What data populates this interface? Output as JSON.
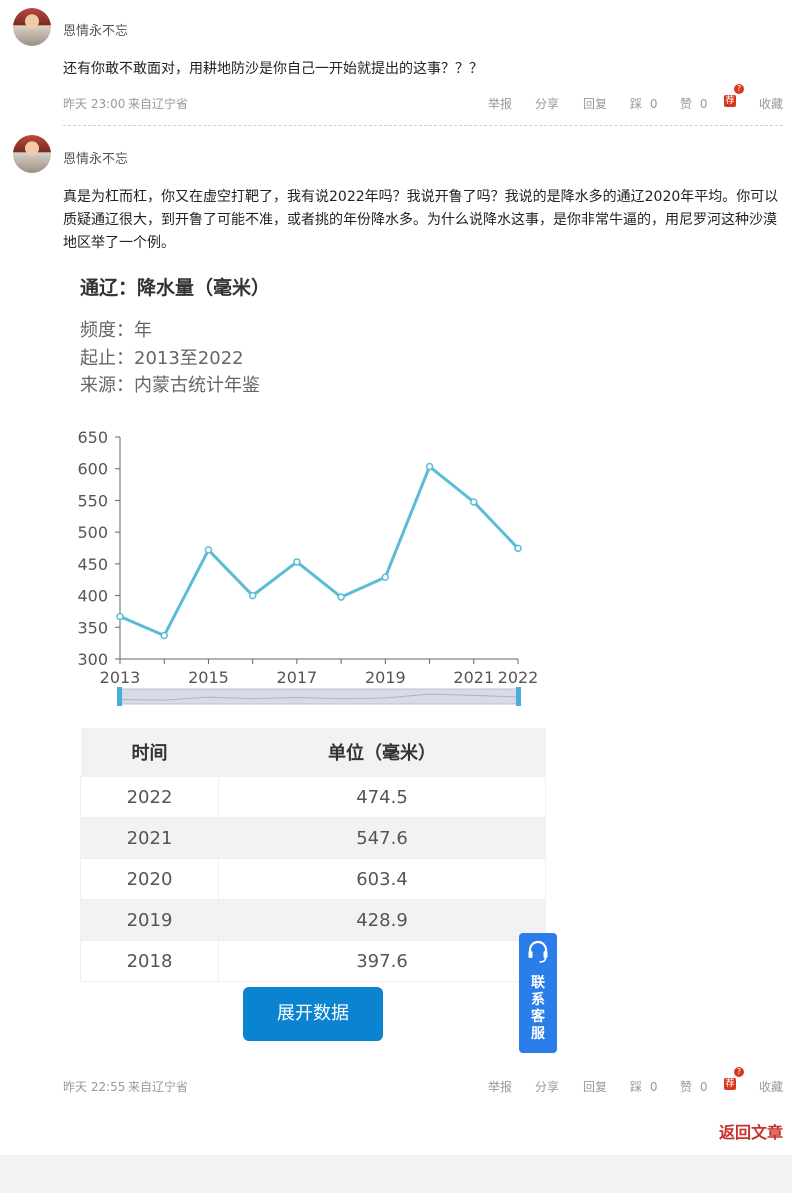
{
  "comments": [
    {
      "user": "恩情永不忘",
      "text": "还有你敢不敢面对，用耕地防沙是你自己一开始就提出的这事？？？",
      "time": "昨天 23:00",
      "source": "来自辽宁省"
    },
    {
      "user": "恩情永不忘",
      "text": "真是为杠而杠，你又在虚空打靶了，我有说2022年吗？我说开鲁了吗？我说的是降水多的通辽2020年平均。你可以质疑通辽很大，到开鲁了可能不准，或者挑的年份降水多。为什么说降水这事，是你非常牛逼的，用尼罗河这种沙漠地区举了一个例。",
      "time": "昨天 22:55",
      "source": "来自辽宁省"
    }
  ],
  "actions": {
    "report": "举报",
    "share": "分享",
    "reply": "回复",
    "dislike": "踩",
    "dislike_count": "0",
    "like": "赞",
    "like_count": "0",
    "recommend_icon": "荐",
    "recommend_badge": "?",
    "favorite": "收藏"
  },
  "chart_info": {
    "title": "通辽：降水量（毫米）",
    "frequency": "频度：年",
    "range": "起止：2013至2022",
    "source": "来源：内蒙古统计年鉴"
  },
  "chart_data": {
    "type": "line",
    "x": [
      2013,
      2014,
      2015,
      2016,
      2017,
      2018,
      2019,
      2020,
      2021,
      2022
    ],
    "values": [
      367,
      337,
      472,
      400,
      453,
      397.6,
      428.9,
      603.4,
      547.6,
      474.5
    ],
    "ylim": [
      300,
      650
    ],
    "yticks": [
      "300",
      "350",
      "400",
      "450",
      "500",
      "550",
      "600",
      "650"
    ],
    "xticks": [
      "2013",
      "2015",
      "2017",
      "2019",
      "2021",
      "2022"
    ],
    "color": "#5bbcd6",
    "grid": false
  },
  "table": {
    "headers": [
      "时间",
      "单位（毫米）"
    ],
    "rows": [
      [
        "2022",
        "474.5"
      ],
      [
        "2021",
        "547.6"
      ],
      [
        "2020",
        "603.4"
      ],
      [
        "2019",
        "428.9"
      ],
      [
        "2018",
        "397.6"
      ]
    ]
  },
  "expand_button": "展开数据",
  "customer_service": "联系客服",
  "back_link": "返回文章"
}
